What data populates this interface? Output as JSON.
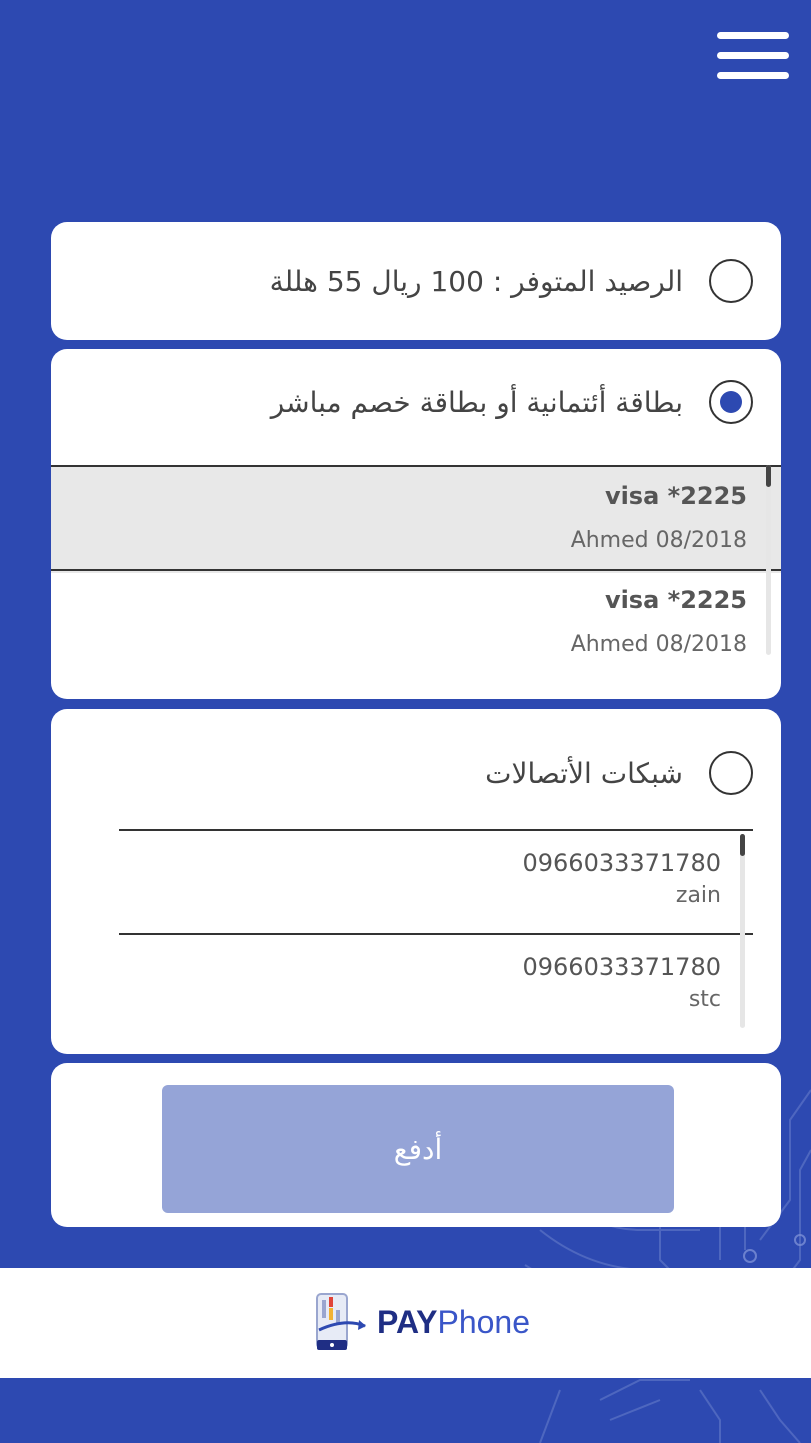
{
  "header": {
    "menu_icon": "hamburger-menu-icon"
  },
  "balance_option": {
    "label": "الرصيد المتوفر : 100 ريال 55 هللة",
    "checked": false
  },
  "card_option": {
    "label": "بطاقة أئتمانية  أو بطاقة خصم مباشر",
    "checked": true,
    "cards": [
      {
        "title": "visa *2225",
        "subtitle": "Ahmed 08/2018",
        "selected": true
      },
      {
        "title": "visa *2225",
        "subtitle": "Ahmed 08/2018",
        "selected": false
      }
    ]
  },
  "telecom_option": {
    "label": "شبكات الأتصالات",
    "checked": false,
    "numbers": [
      {
        "number": "0966033371780",
        "network": "zain"
      },
      {
        "number": "0966033371780",
        "network": "stc"
      }
    ]
  },
  "pay_button": {
    "label": "أدفع"
  },
  "footer": {
    "brand_pay": "PAY",
    "brand_phone": "Phone"
  },
  "colors": {
    "background": "#2d49b1",
    "pay_button": "#95a4d7",
    "radio_fill": "#2d49b1"
  }
}
